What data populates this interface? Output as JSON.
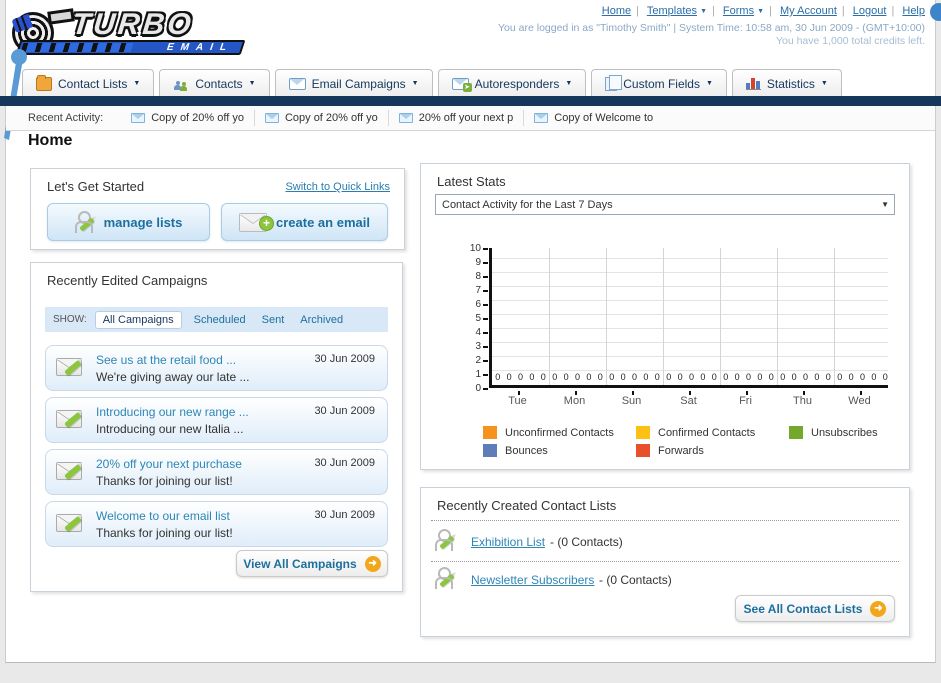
{
  "header": {
    "nav_links": {
      "home": "Home",
      "templates": "Templates",
      "forms": "Forms",
      "my_account": "My Account",
      "logout": "Logout",
      "help": "Help"
    },
    "status_line1": "You are logged in as \"Timothy Smith\" | System Time: 10:58 am, 30 Jun 2009 - (GMT+10:00)",
    "status_line2": "You have 1,000 total credits left.",
    "logo_line1": "TURBO",
    "logo_line2": "EMAIL"
  },
  "main_nav": {
    "tabs": [
      {
        "label": "Contact Lists"
      },
      {
        "label": "Contacts"
      },
      {
        "label": "Email Campaigns"
      },
      {
        "label": "Autoresponders"
      },
      {
        "label": "Custom Fields"
      },
      {
        "label": "Statistics"
      }
    ]
  },
  "recent_activity": {
    "label": "Recent Activity:",
    "items": [
      "Copy of 20% off yo",
      "Copy of 20% off yo",
      "20% off your next p",
      "Copy of Welcome to"
    ]
  },
  "page_title": "Home",
  "get_started": {
    "title": "Let's Get Started",
    "switch_link": "Switch to Quick Links",
    "manage_lists_label": "manage lists",
    "create_email_label": "create an email"
  },
  "campaigns": {
    "title": "Recently Edited Campaigns",
    "show_label": "SHOW:",
    "filters": [
      "All Campaigns",
      "Scheduled",
      "Sent",
      "Archived"
    ],
    "active_filter": "All Campaigns",
    "rows": [
      {
        "title": "See us at the retail food ...",
        "subtitle": "We're giving away our late ...",
        "date": "30 Jun 2009"
      },
      {
        "title": "Introducing our new range ...",
        "subtitle": "Introducing our new Italia ...",
        "date": "30 Jun 2009"
      },
      {
        "title": "20% off your next purchase",
        "subtitle": "Thanks for joining our list!",
        "date": "30 Jun 2009"
      },
      {
        "title": "Welcome to our email list",
        "subtitle": "Thanks for joining our list!",
        "date": "30 Jun 2009"
      }
    ],
    "view_all_label": "View All Campaigns"
  },
  "latest_stats": {
    "title": "Latest Stats",
    "selected_option": "Contact Activity for the Last 7 Days"
  },
  "chart_data": {
    "type": "bar",
    "title": "Contact Activity for the Last 7 Days",
    "categories": [
      "Tue",
      "Mon",
      "Sun",
      "Sat",
      "Fri",
      "Thu",
      "Wed"
    ],
    "series": [
      {
        "name": "Unconfirmed Contacts",
        "color": "#f6921e",
        "values": [
          0,
          0,
          0,
          0,
          0,
          0,
          0
        ]
      },
      {
        "name": "Confirmed Contacts",
        "color": "#fdc116",
        "values": [
          0,
          0,
          0,
          0,
          0,
          0,
          0
        ]
      },
      {
        "name": "Unsubscribes",
        "color": "#74a82c",
        "values": [
          0,
          0,
          0,
          0,
          0,
          0,
          0
        ]
      },
      {
        "name": "Bounces",
        "color": "#5f7db8",
        "values": [
          0,
          0,
          0,
          0,
          0,
          0,
          0
        ]
      },
      {
        "name": "Forwards",
        "color": "#e8502b",
        "values": [
          0,
          0,
          0,
          0,
          0,
          0,
          0
        ]
      }
    ],
    "ylim": [
      0,
      10
    ],
    "yticks": [
      0,
      1,
      2,
      3,
      4,
      5,
      6,
      7,
      8,
      9,
      10
    ],
    "grid": true,
    "legend_position": "bottom",
    "zero_label": "0"
  },
  "contact_lists": {
    "title": "Recently Created Contact Lists",
    "items": [
      {
        "name": "Exhibition List",
        "count": "- (0 Contacts)"
      },
      {
        "name": "Newsletter Subscribers",
        "count": "- (0 Contacts)"
      }
    ],
    "see_all_label": "See All Contact Lists"
  }
}
